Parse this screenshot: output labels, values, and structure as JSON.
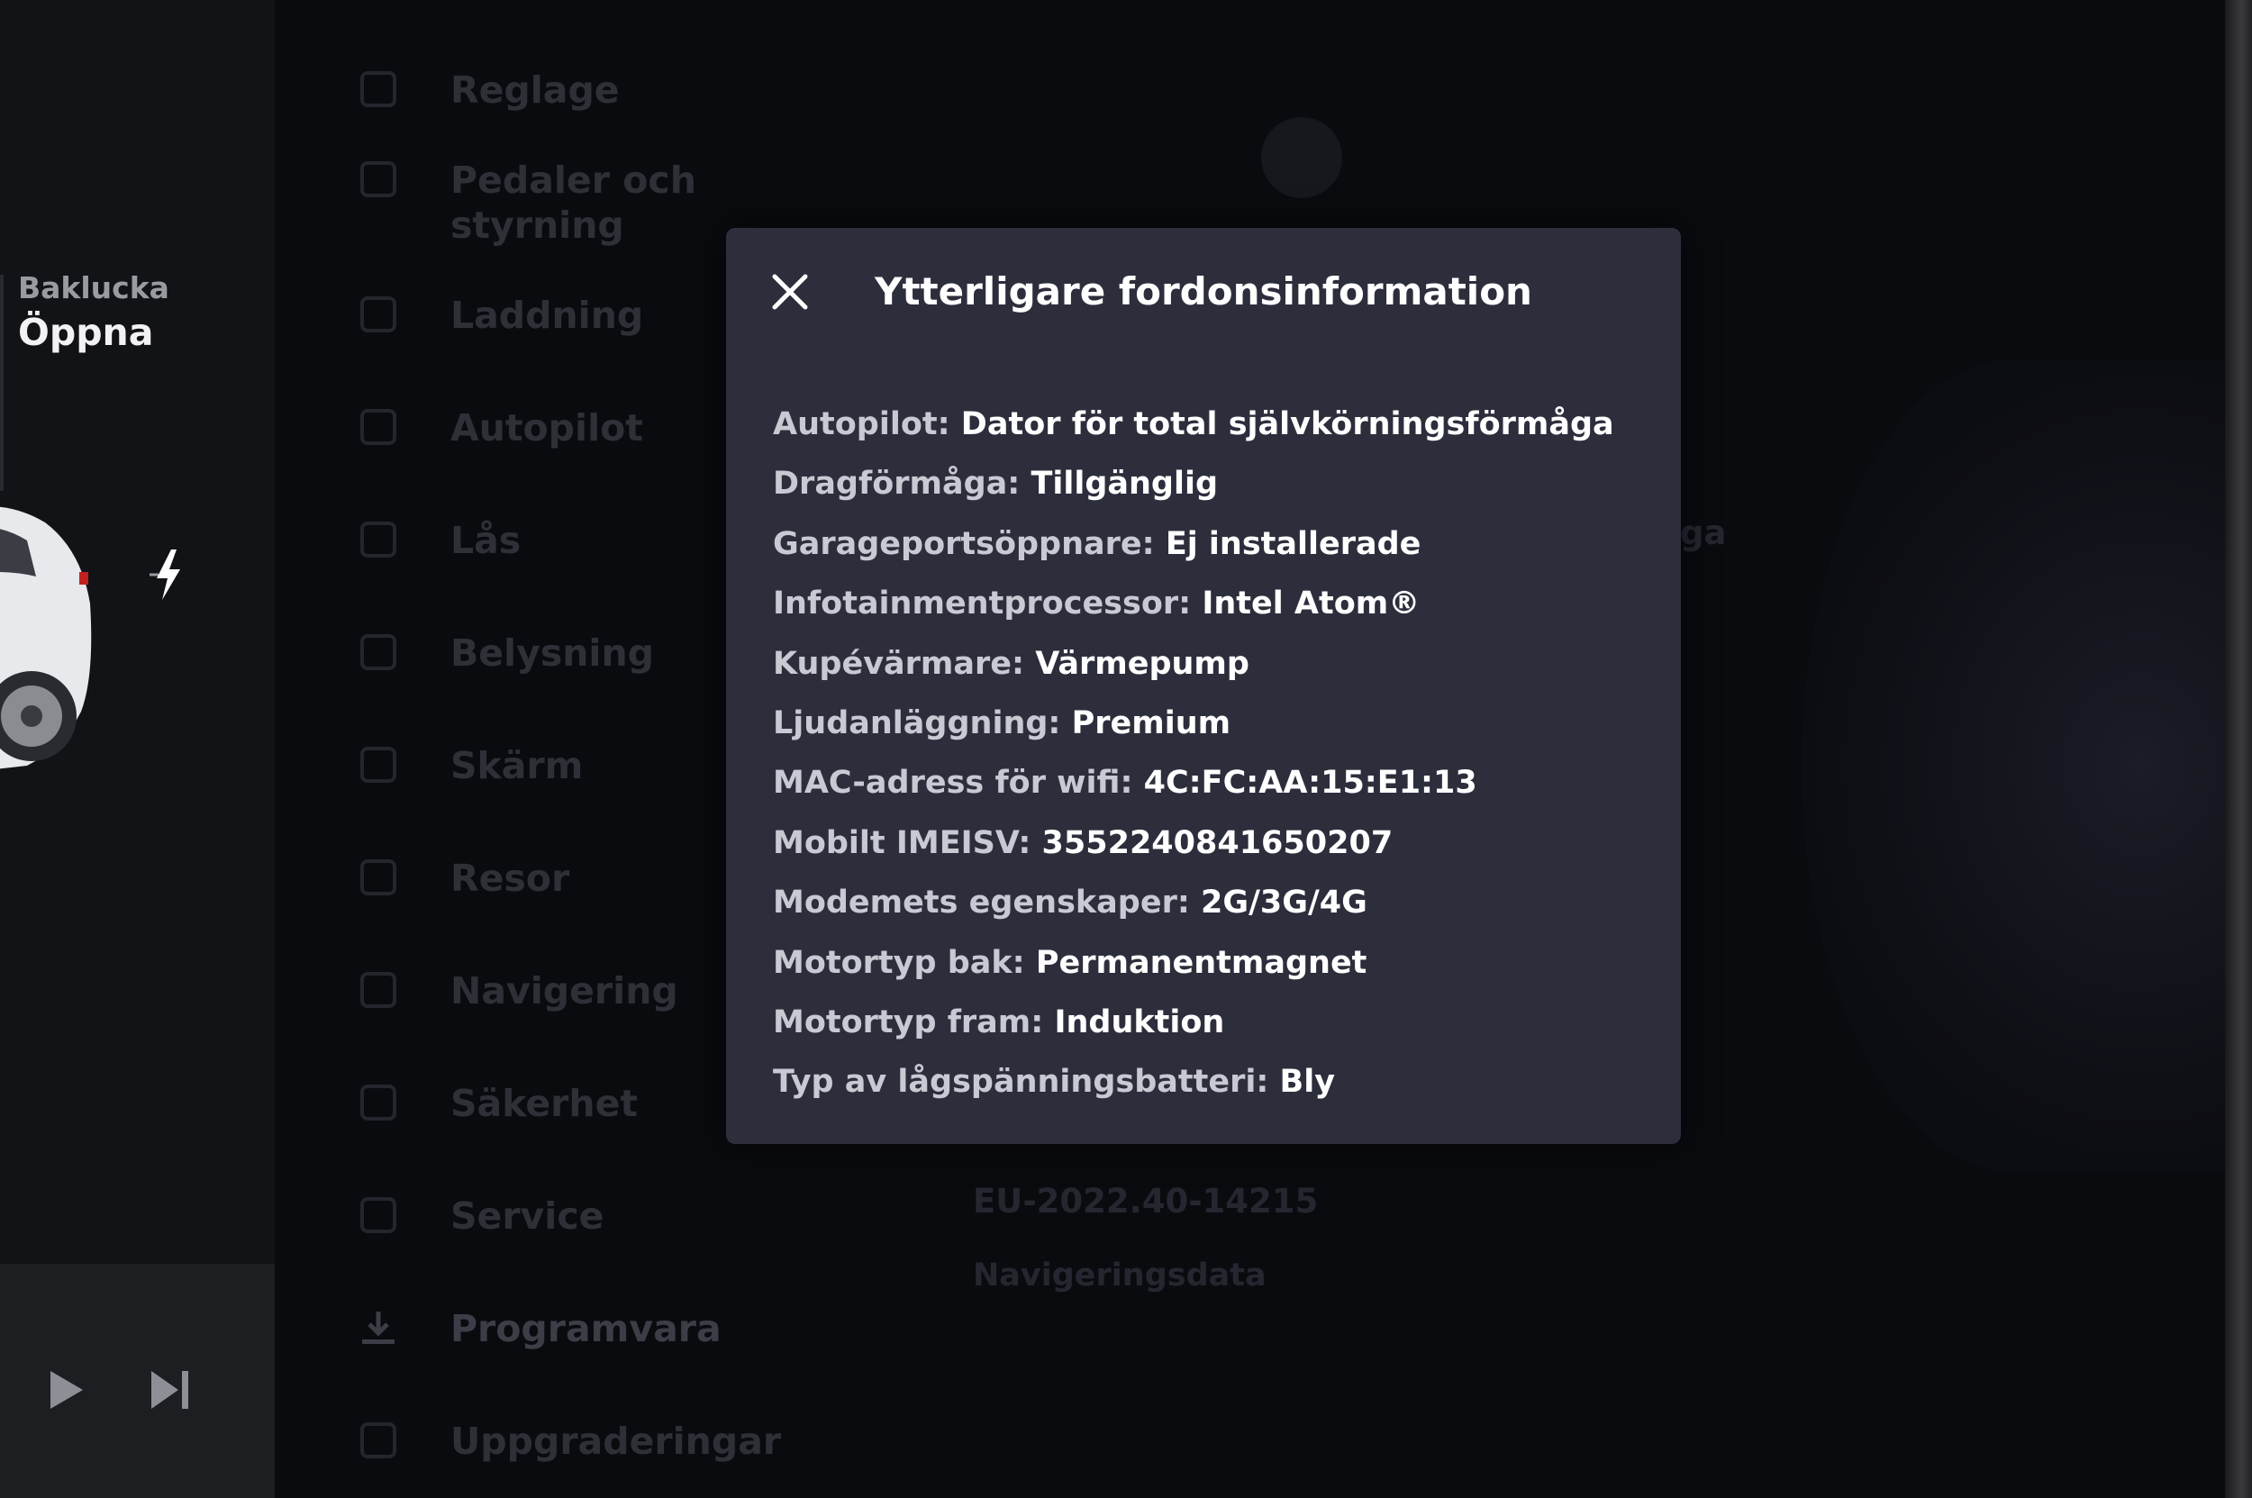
{
  "left_panel": {
    "trunk_label": "Baklucka",
    "trunk_action": "Öppna"
  },
  "menu": {
    "items": [
      {
        "label": "Reglage"
      },
      {
        "label": "Pedaler och styrning"
      },
      {
        "label": "Laddning"
      },
      {
        "label": "Autopilot"
      },
      {
        "label": "Lås"
      },
      {
        "label": "Belysning"
      },
      {
        "label": "Skärm"
      },
      {
        "label": "Resor"
      },
      {
        "label": "Navigering"
      },
      {
        "label": "Säkerhet"
      },
      {
        "label": "Service"
      },
      {
        "label": "Programvara"
      },
      {
        "label": "Uppgraderingar"
      }
    ]
  },
  "background": {
    "faded_tail": "aga",
    "version": "EU-2022.40-14215",
    "nav_data": "Navigeringsdata"
  },
  "modal": {
    "title": "Ytterligare fordonsinformation",
    "rows": [
      {
        "key": "Autopilot:",
        "value": "Dator för total självkörningsförmåga"
      },
      {
        "key": "Dragförmåga:",
        "value": "Tillgänglig"
      },
      {
        "key": "Garageportsöppnare:",
        "value": "Ej installerade"
      },
      {
        "key": "Infotainmentprocessor:",
        "value": "Intel Atom®"
      },
      {
        "key": "Kupévärmare:",
        "value": "Värmepump"
      },
      {
        "key": "Ljudanläggning:",
        "value": "Premium"
      },
      {
        "key": "MAC-adress för wifi:",
        "value": "4C:FC:AA:15:E1:13"
      },
      {
        "key": "Mobilt IMEISV:",
        "value": "3552240841650207"
      },
      {
        "key": "Modemets egenskaper:",
        "value": "2G/3G/4G"
      },
      {
        "key": "Motortyp bak:",
        "value": "Permanentmagnet"
      },
      {
        "key": "Motortyp fram:",
        "value": "Induktion"
      },
      {
        "key": "Typ av lågspänningsbatteri:",
        "value": "Bly"
      }
    ]
  },
  "icons": {
    "close": "close-icon",
    "charge": "lightning-bolt-icon",
    "play": "play-icon",
    "next": "skip-next-icon"
  }
}
